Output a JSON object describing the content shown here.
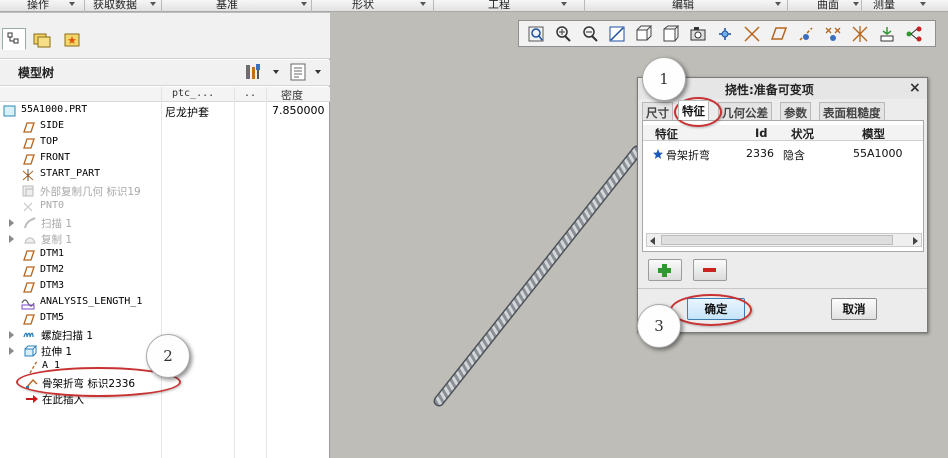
{
  "menu": [
    {
      "label": "操作"
    },
    {
      "label": "获取数据"
    },
    {
      "label": "基准"
    },
    {
      "label": "形状"
    },
    {
      "label": "工程"
    },
    {
      "label": "编辑"
    },
    {
      "label": "曲面"
    },
    {
      "label": "测量"
    }
  ],
  "model_tree": {
    "title": "模型树",
    "columns": [
      "ptc_...",
      "..",
      "密度"
    ],
    "items": [
      {
        "label": "55A1000.PRT",
        "col1": "尼龙护套",
        "col3": "7.850000"
      },
      {
        "label": "SIDE"
      },
      {
        "label": "TOP"
      },
      {
        "label": "FRONT"
      },
      {
        "label": "START_PART"
      },
      {
        "label": "外部复制几何 标识19"
      },
      {
        "label": "PNT0"
      },
      {
        "label": "扫描 1"
      },
      {
        "label": "复制 1"
      },
      {
        "label": "DTM1"
      },
      {
        "label": "DTM2"
      },
      {
        "label": "DTM3"
      },
      {
        "label": "ANALYSIS_LENGTH_1"
      },
      {
        "label": "DTM5"
      },
      {
        "label": "螺旋扫描 1"
      },
      {
        "label": "拉伸 1"
      },
      {
        "label": "A_1"
      },
      {
        "label": "骨架折弯 标识2336"
      },
      {
        "label": "在此插入"
      }
    ]
  },
  "dialog": {
    "title": "挠性:准备可变项",
    "close": "×",
    "tabs": [
      "尺寸",
      "特征",
      "几何公差",
      "参数",
      "表面粗糙度"
    ],
    "columns": [
      "特征",
      "Id",
      "状况",
      "模型"
    ],
    "rows": [
      {
        "feature": "骨架折弯",
        "id": "2336",
        "status": "隐含",
        "model": "55A1000"
      }
    ],
    "ok": "确定",
    "cancel": "取消"
  },
  "callouts": [
    "1",
    "2",
    "3"
  ],
  "colors": {
    "annotation_red": "#c83232",
    "ok_blue": "#3d7fb5",
    "plus_green": "#2e9a2e",
    "minus_red": "#cc2222"
  }
}
